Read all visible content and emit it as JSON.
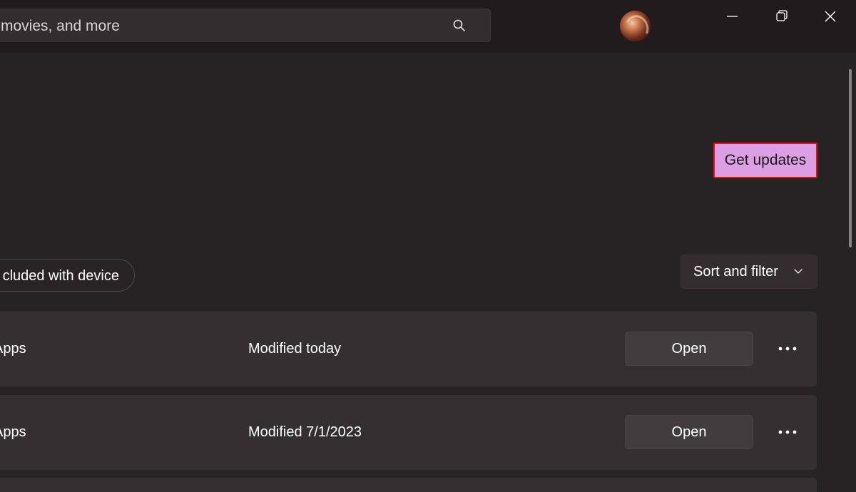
{
  "search": {
    "placeholder_visible": "movies, and more"
  },
  "icons": {
    "search": "search-icon",
    "minimize": "minimize-icon",
    "restore": "restore-icon",
    "close": "close-icon",
    "chevron": "chevron-down-icon",
    "more": "more-horizontal-icon"
  },
  "colors": {
    "accent": "#dc9fe3",
    "highlight_border": "#e0111c",
    "background": "#272224"
  },
  "header": {
    "get_updates_label": "Get updates"
  },
  "filters": {
    "chip_label": "cluded with device",
    "sort_label": "Sort and filter"
  },
  "list": {
    "rows": [
      {
        "name": "Apps",
        "modified": "Modified today",
        "action": "Open"
      },
      {
        "name": "Apps",
        "modified": "Modified 7/1/2023",
        "action": "Open"
      }
    ]
  }
}
